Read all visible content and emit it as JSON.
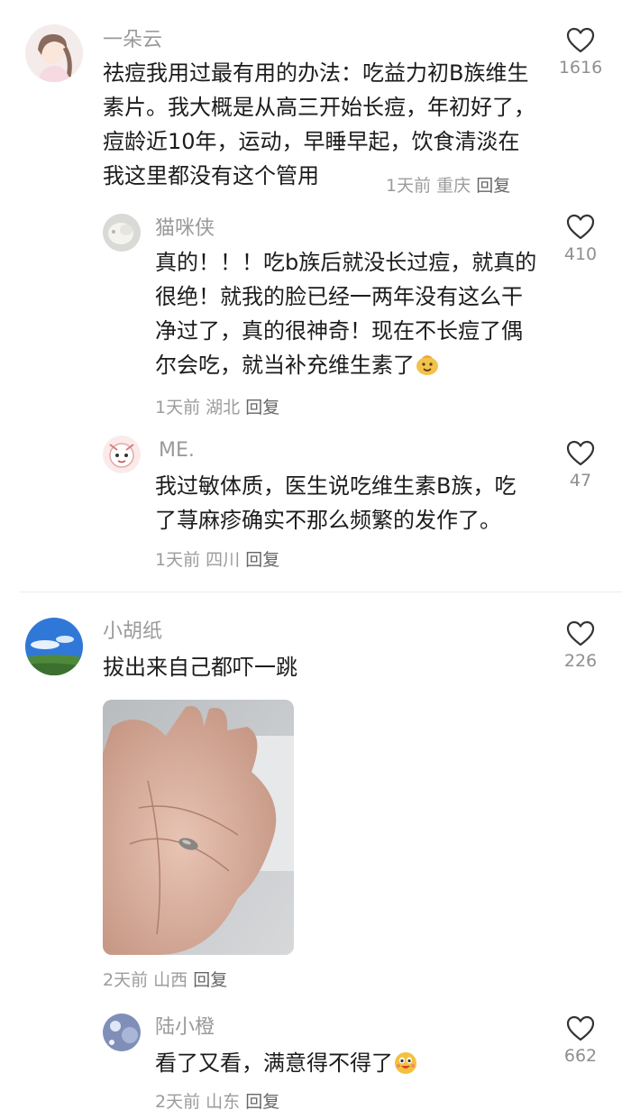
{
  "comments": [
    {
      "name": "一朵云",
      "text": "祛痘我用过最有用的办法：吃益力初B族维生素片。我大概是从高三开始长痘，年初好了，痘龄近10年，运动，早睡早起，饮食清淡在我这里都没有这个管用",
      "time": "1天前",
      "location": "重庆",
      "reply_label": "回复",
      "likes": "1616",
      "replies": [
        {
          "name": "猫咪侠",
          "text": "真的！！！吃b族后就没长过痘，就真的很绝！就我的脸已经一两年没有这么干净过了，真的很神奇！现在不长痘了偶尔会吃，就当补充维生素了",
          "emoji": "smiling-face-emoji",
          "time": "1天前",
          "location": "湖北",
          "reply_label": "回复",
          "likes": "410"
        },
        {
          "name": "ME.",
          "text": "我过敏体质，医生说吃维生素B族，吃了荨麻疹确实不那么频繁的发作了。",
          "time": "1天前",
          "location": "四川",
          "reply_label": "回复",
          "likes": "47"
        }
      ]
    },
    {
      "name": "小胡纸",
      "text": "拔出来自己都吓一跳",
      "image": "palm-photo",
      "time": "2天前",
      "location": "山西",
      "reply_label": "回复",
      "likes": "226",
      "replies": [
        {
          "name": "陆小橙",
          "text": "看了又看，满意得不得了",
          "emoji": "excited-face-emoji",
          "time": "2天前",
          "location": "山东",
          "reply_label": "回复",
          "likes": "662"
        }
      ]
    }
  ]
}
